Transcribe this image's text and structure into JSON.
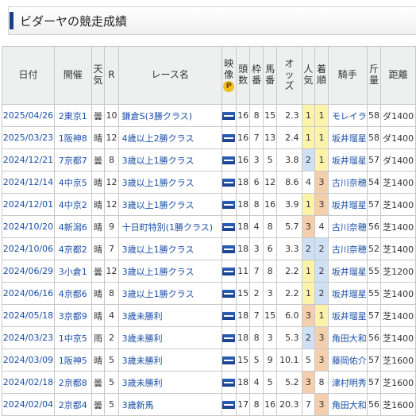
{
  "page": {
    "title": "ビダーヤの競走成績"
  },
  "header": {
    "date": "日付",
    "venue": "開催",
    "weather": [
      "天",
      "気"
    ],
    "r": "R",
    "race": "レース名",
    "video": [
      "映",
      "像"
    ],
    "video_badge": "P",
    "runners": [
      "頭",
      "数"
    ],
    "gate": [
      "枠",
      "番"
    ],
    "horse_no": [
      "馬",
      "番"
    ],
    "odds": [
      "オ",
      "ッ",
      "ズ"
    ],
    "pop": [
      "人",
      "気"
    ],
    "finish": [
      "着",
      "順"
    ],
    "jockey": "騎手",
    "weight": [
      "斤",
      "量"
    ],
    "distance": "距離"
  },
  "rows": [
    {
      "date": "2025/04/26",
      "venue": "2東京1",
      "weather": "曇",
      "r": "10",
      "race": "鎌倉S(3勝クラス)",
      "runners": "16",
      "gate": "8",
      "horse_no": "15",
      "odds": "2.3",
      "pop": "1",
      "finish": "1",
      "jockey": "モレイラ",
      "weight": "58",
      "distance": "ダ1400"
    },
    {
      "date": "2025/03/23",
      "venue": "1阪神8",
      "weather": "晴",
      "r": "12",
      "race": "4歳以上2勝クラス",
      "runners": "16",
      "gate": "7",
      "horse_no": "13",
      "odds": "2.4",
      "pop": "1",
      "finish": "1",
      "jockey": "坂井瑠星",
      "weight": "58",
      "distance": "ダ1400"
    },
    {
      "date": "2024/12/21",
      "venue": "7京都7",
      "weather": "曇",
      "r": "8",
      "race": "3歳以上1勝クラス",
      "runners": "16",
      "gate": "3",
      "horse_no": "5",
      "odds": "3.8",
      "pop": "2",
      "finish": "1",
      "jockey": "坂井瑠星",
      "weight": "57",
      "distance": "ダ1400"
    },
    {
      "date": "2024/12/14",
      "venue": "4中京5",
      "weather": "晴",
      "r": "12",
      "race": "3歳以上1勝クラス",
      "runners": "18",
      "gate": "6",
      "horse_no": "12",
      "odds": "8.6",
      "pop": "4",
      "finish": "3",
      "jockey": "古川奈穂",
      "weight": "54",
      "distance": "芝1400"
    },
    {
      "date": "2024/12/01",
      "venue": "4中京2",
      "weather": "晴",
      "r": "12",
      "race": "3歳以上1勝クラス",
      "runners": "18",
      "gate": "8",
      "horse_no": "16",
      "odds": "3.9",
      "pop": "1",
      "finish": "3",
      "jockey": "坂井瑠星",
      "weight": "57",
      "distance": "芝1400"
    },
    {
      "date": "2024/10/20",
      "venue": "4新潟6",
      "weather": "晴",
      "r": "9",
      "race": "十日町特別(1勝クラス)",
      "runners": "18",
      "gate": "4",
      "horse_no": "8",
      "odds": "5.7",
      "pop": "3",
      "finish": "4",
      "jockey": "古川奈穂",
      "weight": "56",
      "distance": "芝1400"
    },
    {
      "date": "2024/10/06",
      "venue": "4京都2",
      "weather": "晴",
      "r": "7",
      "race": "3歳以上1勝クラス",
      "runners": "18",
      "gate": "3",
      "horse_no": "6",
      "odds": "3.3",
      "pop": "2",
      "finish": "2",
      "jockey": "古川奈穂",
      "weight": "52",
      "distance": "芝1400"
    },
    {
      "date": "2024/06/29",
      "venue": "3小倉1",
      "weather": "曇",
      "r": "12",
      "race": "3歳以上1勝クラス",
      "runners": "11",
      "gate": "7",
      "horse_no": "8",
      "odds": "2.2",
      "pop": "1",
      "finish": "2",
      "jockey": "坂井瑠星",
      "weight": "55",
      "distance": "芝1200"
    },
    {
      "date": "2024/06/16",
      "venue": "4京都6",
      "weather": "晴",
      "r": "8",
      "race": "3歳以上1勝クラス",
      "runners": "15",
      "gate": "2",
      "horse_no": "3",
      "odds": "2.2",
      "pop": "1",
      "finish": "2",
      "jockey": "坂井瑠星",
      "weight": "55",
      "distance": "芝1400"
    },
    {
      "date": "2024/05/18",
      "venue": "3京都9",
      "weather": "晴",
      "r": "4",
      "race": "3歳未勝利",
      "runners": "18",
      "gate": "7",
      "horse_no": "15",
      "odds": "6.0",
      "pop": "3",
      "finish": "1",
      "jockey": "坂井瑠星",
      "weight": "57",
      "distance": "芝1400"
    },
    {
      "date": "2024/03/23",
      "venue": "1中京5",
      "weather": "雨",
      "r": "2",
      "race": "3歳未勝利",
      "runners": "18",
      "gate": "8",
      "horse_no": "3",
      "odds": "5.3",
      "pop": "2",
      "finish": "3",
      "jockey": "角田大和",
      "weight": "56",
      "distance": "芝1400"
    },
    {
      "date": "2024/03/09",
      "venue": "1阪神5",
      "weather": "晴",
      "r": "5",
      "race": "3歳未勝利",
      "runners": "15",
      "gate": "5",
      "horse_no": "9",
      "odds": "10.1",
      "pop": "5",
      "finish": "3",
      "jockey": "藤岡佑介",
      "weight": "57",
      "distance": "芝1600"
    },
    {
      "date": "2024/02/18",
      "venue": "2京都8",
      "weather": "曇",
      "r": "5",
      "race": "3歳未勝利",
      "runners": "18",
      "gate": "4",
      "horse_no": "5",
      "odds": "5.2",
      "pop": "3",
      "finish": "8",
      "jockey": "津村明秀",
      "weight": "57",
      "distance": "芝1600"
    },
    {
      "date": "2024/02/04",
      "venue": "2京都4",
      "weather": "曇",
      "r": "5",
      "race": "3歳新馬",
      "runners": "17",
      "gate": "8",
      "horse_no": "16",
      "odds": "20.3",
      "pop": "7",
      "finish": "3",
      "jockey": "角田大和",
      "weight": "56",
      "distance": "芝1600"
    }
  ]
}
